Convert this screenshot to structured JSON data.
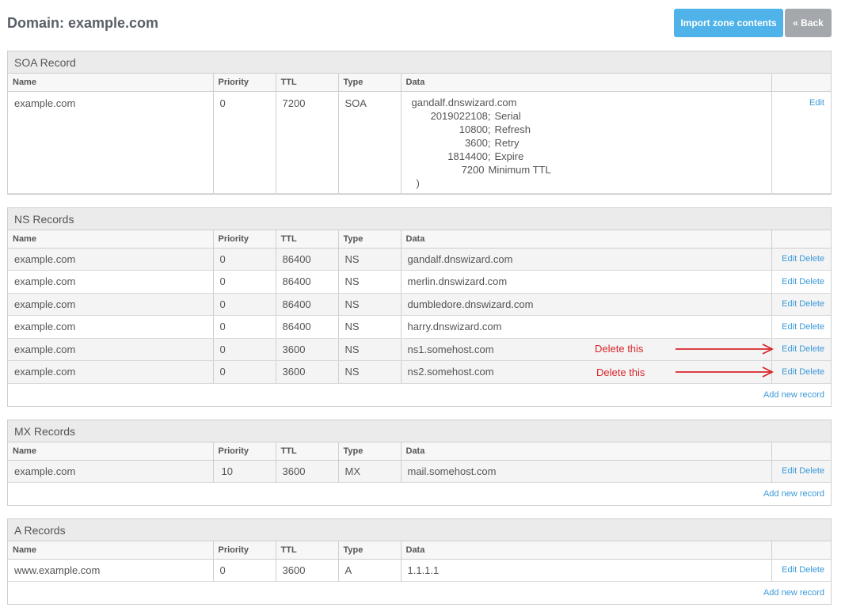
{
  "header": {
    "title": "Domain: example.com",
    "import_label": "Import zone contents",
    "back_label": "« Back"
  },
  "columns": [
    "Name",
    "Priority",
    "TTL",
    "Type",
    "Data"
  ],
  "soa": {
    "title": "SOA Record",
    "name": "example.com",
    "priority": "0",
    "ttl": "7200",
    "type": "SOA",
    "primary": "gandalf.dnswizard.com",
    "fields": [
      {
        "value": "2019022108;",
        "label": "Serial"
      },
      {
        "value": "10800;",
        "label": "Refresh"
      },
      {
        "value": "3600;",
        "label": "Retry"
      },
      {
        "value": "1814400;",
        "label": "Expire"
      },
      {
        "value": "7200",
        "label": "Minimum TTL"
      }
    ],
    "close": ")",
    "edit": "Edit"
  },
  "ns": {
    "title": "NS Records",
    "rows": [
      {
        "name": "example.com",
        "priority": "0",
        "ttl": "86400",
        "type": "NS",
        "data": "gandalf.dnswizard.com"
      },
      {
        "name": "example.com",
        "priority": "0",
        "ttl": "86400",
        "type": "NS",
        "data": "merlin.dnswizard.com"
      },
      {
        "name": "example.com",
        "priority": "0",
        "ttl": "86400",
        "type": "NS",
        "data": "dumbledore.dnswizard.com"
      },
      {
        "name": "example.com",
        "priority": "0",
        "ttl": "86400",
        "type": "NS",
        "data": "harry.dnswizard.com"
      },
      {
        "name": "example.com",
        "priority": "0",
        "ttl": "3600",
        "type": "NS",
        "data": "ns1.somehost.com"
      },
      {
        "name": "example.com",
        "priority": "0",
        "ttl": "3600",
        "type": "NS",
        "data": "ns2.somehost.com"
      }
    ],
    "add": "Add new record"
  },
  "mx": {
    "title": "MX Records",
    "rows": [
      {
        "name": "example.com",
        "priority": "10",
        "ttl": "3600",
        "type": "MX",
        "data": "mail.somehost.com"
      }
    ],
    "add": "Add new record"
  },
  "a": {
    "title": "A Records",
    "rows": [
      {
        "name": "www.example.com",
        "priority": "0",
        "ttl": "3600",
        "type": "A",
        "data": "1.1.1.1"
      }
    ],
    "add": "Add new record"
  },
  "actions": {
    "edit": "Edit",
    "delete": "Delete"
  },
  "annotations": [
    "Delete this",
    "Delete this"
  ],
  "colors": {
    "accent": "#4fb3e9",
    "link": "#3a9ad9",
    "annotation": "#d9252b"
  }
}
